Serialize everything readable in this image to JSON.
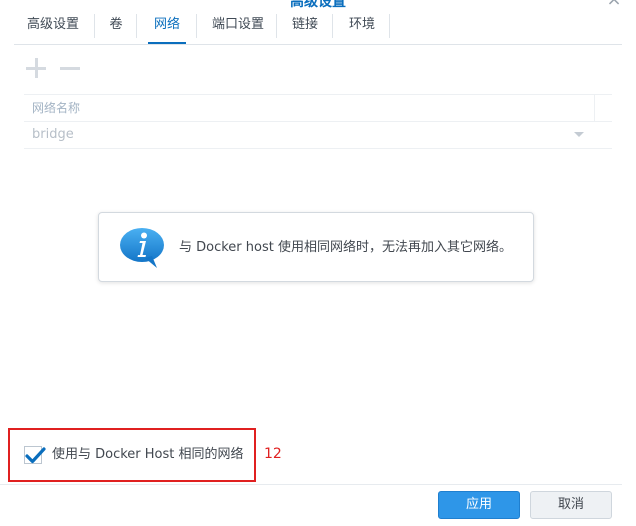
{
  "window": {
    "title": "高级设置"
  },
  "tabs": [
    {
      "label": "高级设置",
      "active": false
    },
    {
      "label": "卷",
      "active": false
    },
    {
      "label": "网络",
      "active": true
    },
    {
      "label": "端口设置",
      "active": false
    },
    {
      "label": "链接",
      "active": false
    },
    {
      "label": "环境",
      "active": false
    }
  ],
  "toolbar": {
    "add_icon": "plus-icon",
    "remove_icon": "minus-icon"
  },
  "grid": {
    "columns": [
      "网络名称"
    ],
    "rows": [
      {
        "network_name": "bridge"
      }
    ]
  },
  "info": {
    "icon": "info-icon",
    "message": "与 Docker host 使用相同网络时，无法再加入其它网络。"
  },
  "host_network": {
    "checked": true,
    "label": "使用与 Docker Host 相同的网络"
  },
  "annotation": {
    "text": "12",
    "color": "#e02020"
  },
  "footer": {
    "apply_label": "应用",
    "cancel_label": "取消"
  },
  "colors": {
    "accent": "#0a6ebd",
    "primary_button": "#2e96e8"
  }
}
